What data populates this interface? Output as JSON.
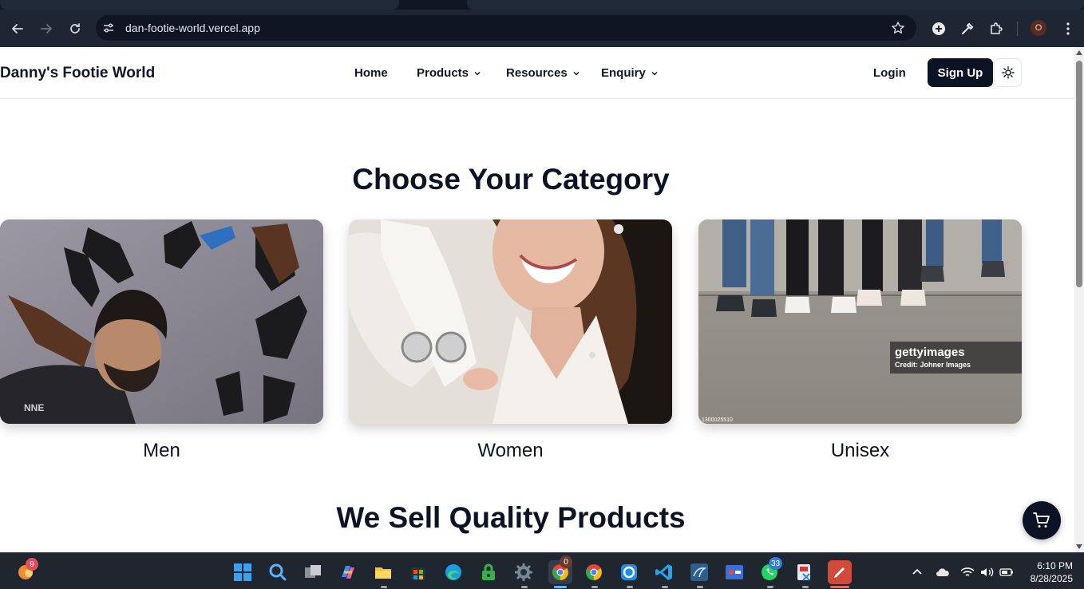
{
  "browser": {
    "url": "dan-footie-world.vercel.app",
    "profile_initial": "O"
  },
  "site": {
    "brand": "Danny's Footie World",
    "nav": [
      {
        "label": "Home"
      },
      {
        "label": "Products"
      },
      {
        "label": "Resources"
      },
      {
        "label": "Enquiry"
      }
    ],
    "login_label": "Login",
    "signup_label": "Sign Up"
  },
  "content": {
    "category_title": "Choose Your Category",
    "categories": [
      {
        "label": "Men"
      },
      {
        "label": "Women"
      },
      {
        "label": "Unisex"
      }
    ],
    "watermark": {
      "brand": "gettyimages",
      "credit": "Credit: Johner Images",
      "id": "1300025510"
    },
    "quality_title": "We Sell Quality Products"
  },
  "taskbar": {
    "weather_badge": "9",
    "chrome_badge": "0",
    "whatsapp_badge": "33",
    "time": "6:10 PM",
    "date": "8/28/2025"
  },
  "colors": {
    "primary_button": "#0b1324",
    "chrome_toolbar": "#1e2533",
    "taskbar": "#1f2630"
  }
}
